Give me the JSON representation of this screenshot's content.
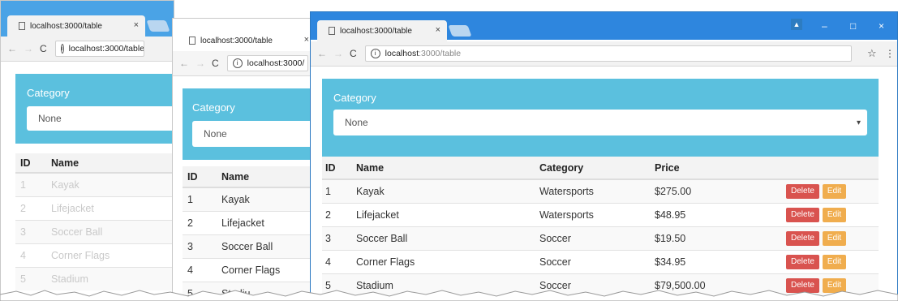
{
  "browser": {
    "tab_title": "localhost:3000/table",
    "tab_close": "×",
    "url_host": "localhost",
    "url_path": ":3000/table",
    "url_full": "localhost:3000/table",
    "url_partial": "localhost:3000/",
    "back": "←",
    "forward": "→",
    "reload": "C",
    "info": "i",
    "star": "☆",
    "menu": "⋮"
  },
  "window_controls": {
    "minimize": "–",
    "maximize": "□",
    "close": "×"
  },
  "filter": {
    "label": "Category",
    "selected": "None",
    "chevron": "▾"
  },
  "table": {
    "headers": {
      "id": "ID",
      "name": "Name",
      "category": "Category",
      "price": "Price"
    },
    "rows": [
      {
        "id": "1",
        "name": "Kayak",
        "category": "Watersports",
        "price": "$275.00"
      },
      {
        "id": "2",
        "name": "Lifejacket",
        "category": "Watersports",
        "price": "$48.95"
      },
      {
        "id": "3",
        "name": "Soccer Ball",
        "category": "Soccer",
        "price": "$19.50"
      },
      {
        "id": "4",
        "name": "Corner Flags",
        "category": "Soccer",
        "price": "$34.95"
      },
      {
        "id": "5",
        "name": "Stadium",
        "category": "Soccer",
        "price": "$79,500.00"
      }
    ],
    "actions": {
      "delete": "Delete",
      "edit": "Edit"
    },
    "partial_row5_name": "Stadiu"
  },
  "colors": {
    "titlebar": "#4aa3e6",
    "panel": "#5bc0de",
    "delete": "#d9534f",
    "edit": "#f0ad4e"
  }
}
